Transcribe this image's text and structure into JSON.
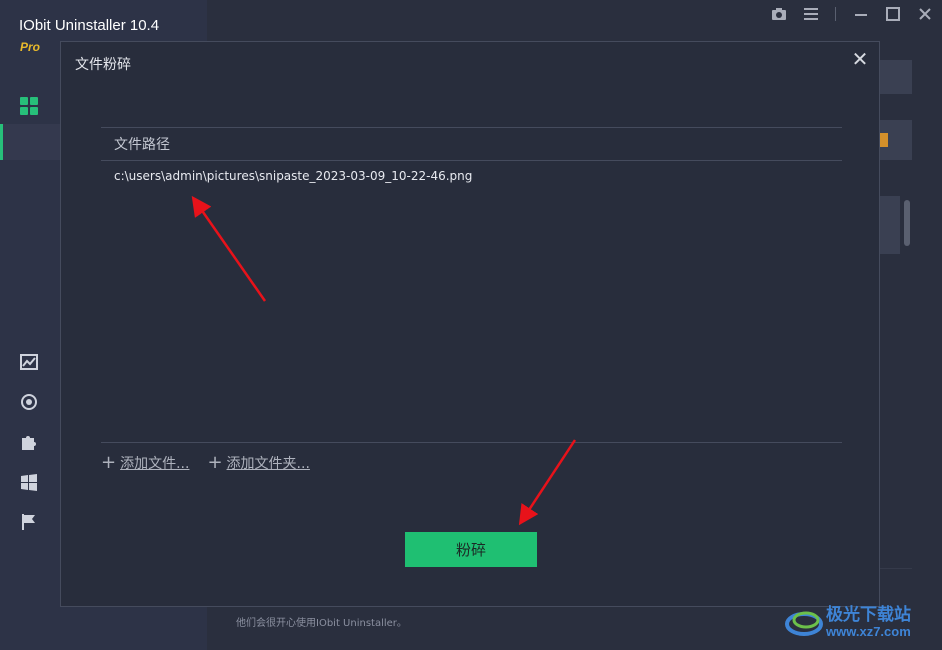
{
  "app": {
    "title": "IObit Uninstaller 10.4",
    "edition": "Pro"
  },
  "background": {
    "footer_text": "他们会很开心使用IObit Uninstaller。"
  },
  "dialog": {
    "title": "文件粉碎",
    "close_label": "✕",
    "table": {
      "column_header": "文件路径",
      "rows": [
        "c:\\users\\admin\\pictures\\snipaste_2023-03-09_10-22-46.png"
      ]
    },
    "add_file_label": "添加文件...",
    "add_folder_label": "添加文件夹...",
    "shred_button_label": "粉碎"
  },
  "watermark": {
    "name": "极光下载站",
    "url": "www.xz7.com"
  },
  "colors": {
    "accent": "#1fbf72",
    "edition": "#e8b92b",
    "annotation_arrow": "#e8121a",
    "dialog_bg": "#282d3c"
  },
  "icons": {
    "window": [
      "camera-icon",
      "menu-icon",
      "minimize-icon",
      "maximize-icon",
      "close-icon"
    ],
    "sidebar": [
      "grid-icon",
      "chart-icon",
      "refresh-icon",
      "puzzle-icon",
      "windows-icon",
      "flag-icon"
    ]
  }
}
